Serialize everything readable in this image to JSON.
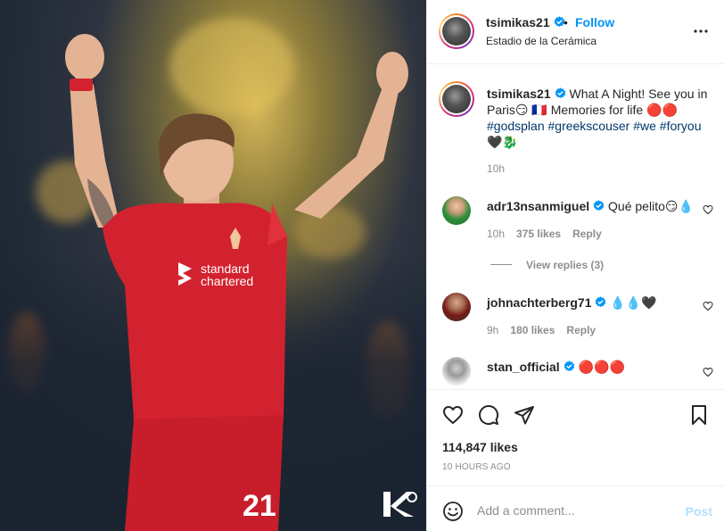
{
  "photo": {
    "alt_subject": "footballer celebrating",
    "sponsor_line1": "standard",
    "sponsor_line2": "chartered",
    "shirt_number": "21"
  },
  "header": {
    "username": "tsimikas21",
    "separator": "•",
    "follow_label": "Follow",
    "location": "Estadio de la Cerámica"
  },
  "caption": {
    "username": "tsimikas21",
    "text": "What A Night! See you in Paris😏 🇫🇷 Memories for life 🔴🔴",
    "hashtags": "#godsplan #greekscouser #we #foryou",
    "emoji_tail": "🖤🐉",
    "time": "10h"
  },
  "comments": [
    {
      "username": "adr13nsanmiguel",
      "text": "Qué pelito😏💧",
      "time": "10h",
      "likes": "375 likes",
      "reply": "Reply"
    },
    {
      "username": "johnachterberg71",
      "text": "💧💧🖤",
      "time": "9h",
      "likes": "180 likes",
      "reply": "Reply"
    },
    {
      "username": "stan_official",
      "text": "🔴🔴🔴",
      "time": "",
      "likes": "",
      "reply": ""
    }
  ],
  "view_replies": "View replies (3)",
  "actions": {
    "likes": "114,847 likes",
    "timeago": "10 HOURS AGO"
  },
  "add_comment": {
    "placeholder": "Add a comment...",
    "post_label": "Post"
  },
  "colors": {
    "link_blue": "#0095f6",
    "hashtag": "#00376b",
    "muted": "#8e8e8e",
    "post_disabled": "#b2dffc",
    "liverpool_red": "#d3222f"
  }
}
